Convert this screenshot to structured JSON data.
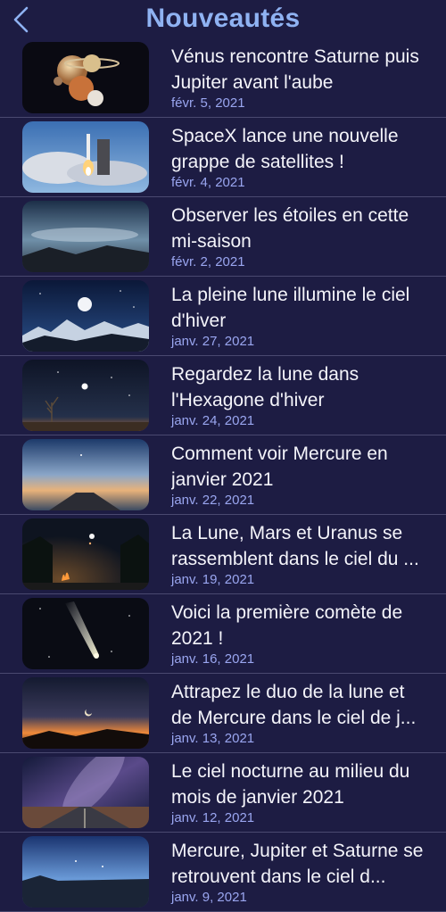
{
  "header": {
    "title": "Nouveautés",
    "back_icon": "chevron-left-icon"
  },
  "articles": [
    {
      "title": "Vénus rencontre Saturne puis Jupiter avant l'aube",
      "date": "févr. 5, 2021",
      "image": "planets-image"
    },
    {
      "title": "SpaceX lance une nouvelle grappe de satellites !",
      "date": "févr. 4, 2021",
      "image": "rocket-launch-image"
    },
    {
      "title": "Observer les étoiles en cette mi-saison",
      "date": "févr. 2, 2021",
      "image": "cloudy-sky-image"
    },
    {
      "title": "La pleine lune illumine le ciel d'hiver",
      "date": "janv. 27, 2021",
      "image": "full-moon-mountains-image"
    },
    {
      "title": "Regardez la lune dans l'Hexagone d'hiver",
      "date": "janv. 24, 2021",
      "image": "moon-tree-image"
    },
    {
      "title": "Comment voir Mercure en janvier 2021",
      "date": "janv. 22, 2021",
      "image": "mercury-pier-image"
    },
    {
      "title": "La Lune, Mars et Uranus se rassemblent dans le ciel du ...",
      "date": "janv. 19, 2021",
      "image": "campfire-night-image"
    },
    {
      "title": "Voici la première comète de 2021 !",
      "date": "janv. 16, 2021",
      "image": "comet-image"
    },
    {
      "title": "Attrapez le duo de la lune et de Mercure dans le ciel de j...",
      "date": "janv. 13, 2021",
      "image": "sunset-crescent-image"
    },
    {
      "title": "Le ciel nocturne au milieu du mois de janvier 2021",
      "date": "janv. 12, 2021",
      "image": "milky-way-road-image"
    },
    {
      "title": "Mercure, Jupiter et Saturne se retrouvent dans le ciel d...",
      "date": "janv. 9, 2021",
      "image": "twilight-lake-image"
    }
  ]
}
